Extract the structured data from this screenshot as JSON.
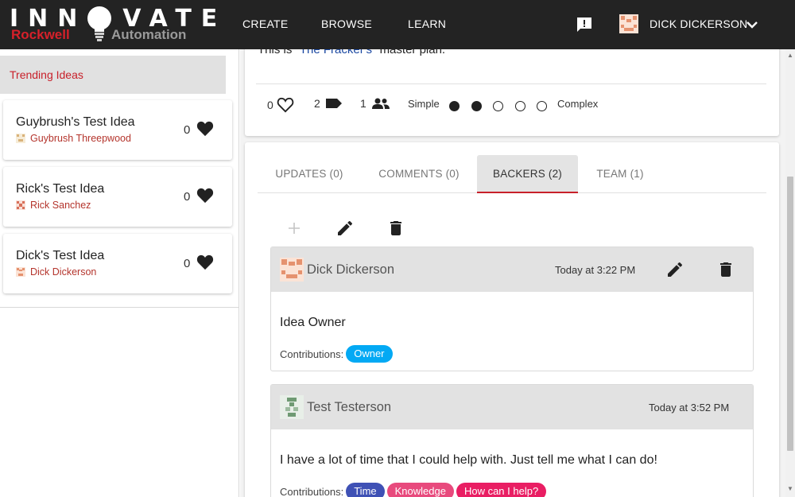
{
  "brand": {
    "title_letters": "INN VATE",
    "maker_red": "Rockwell",
    "maker_grey": "Automation"
  },
  "nav": {
    "links": [
      "CREATE",
      "BROWSE",
      "LEARN"
    ],
    "user_name": "DICK DICKERSON"
  },
  "sidebar": {
    "section_label": "Trending Ideas",
    "ideas": [
      {
        "title": "Guybrush's Test Idea",
        "author": "Guybrush Threepwood",
        "likes": "0"
      },
      {
        "title": "Rick's Test Idea",
        "author": "Rick Sanchez",
        "likes": "0"
      },
      {
        "title": "Dick's Test Idea",
        "author": "Dick Dickerson",
        "likes": "0"
      }
    ]
  },
  "idea": {
    "intro_prefix": "This is",
    "intro_highlight": "The Fracker's",
    "intro_suffix": "master plan.",
    "likes": "0",
    "tags": "2",
    "backers": "1",
    "complexity_low": "Simple",
    "complexity_high": "Complex",
    "complexity_level": 2,
    "complexity_max": 5
  },
  "tabs": [
    {
      "label": "UPDATES (0)",
      "active": false
    },
    {
      "label": "COMMENTS (0)",
      "active": false
    },
    {
      "label": "BACKERS (2)",
      "active": true
    },
    {
      "label": "TEAM (1)",
      "active": false
    }
  ],
  "backers": [
    {
      "name": "Dick Dickerson",
      "time": "Today at 3:22 PM",
      "message": "Idea Owner",
      "contributions_label": "Contributions:",
      "chips": [
        {
          "label": "Owner",
          "color": "#03a9f4"
        }
      ]
    },
    {
      "name": "Test Testerson",
      "time": "Today at 3:52 PM",
      "message": "I have a lot of time that I could help with. Just tell me what I can do!",
      "contributions_label": "Contributions:",
      "chips": [
        {
          "label": "Time",
          "color": "#3f51b5"
        },
        {
          "label": "Knowledge",
          "color": "#e84a7d"
        },
        {
          "label": "How can I help?",
          "color": "#e91e63"
        }
      ]
    }
  ],
  "colors": {
    "nav_bg": "#232323",
    "accent_red": "#c8202a",
    "author_red": "#b4342c",
    "link_blue": "#1a47a0"
  }
}
